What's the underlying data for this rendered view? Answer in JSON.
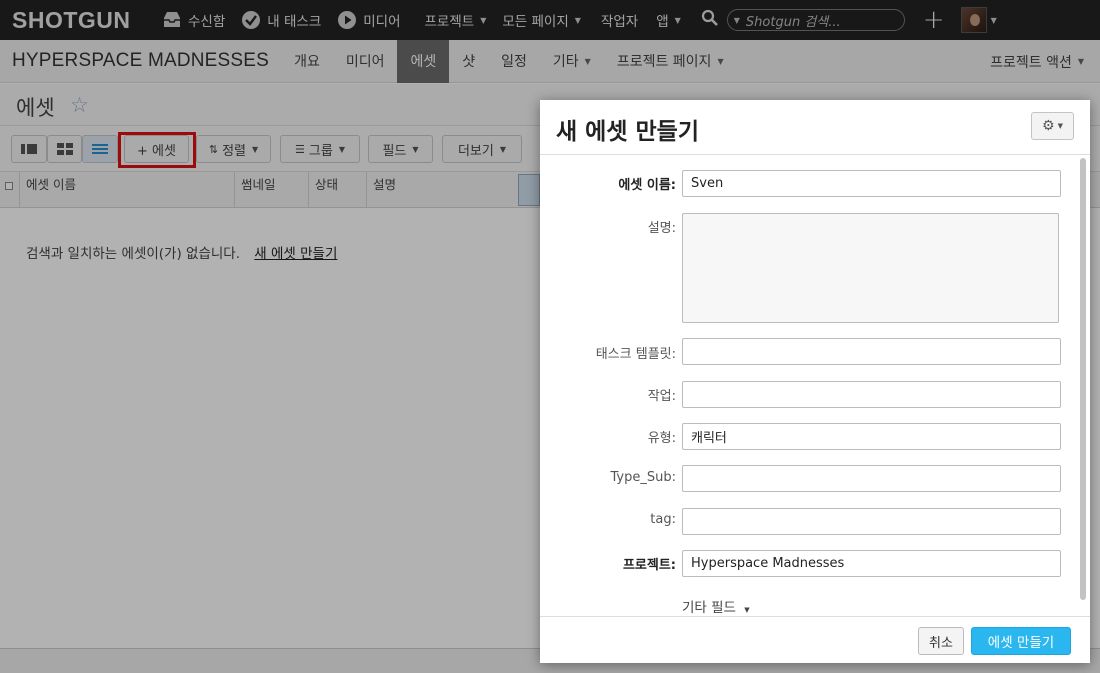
{
  "topnav": {
    "logo": "SHOTGUN",
    "items": [
      {
        "label": "수신함",
        "icon": "inbox-icon"
      },
      {
        "label": "내 태스크",
        "icon": "checkmark-icon"
      },
      {
        "label": "미디어",
        "icon": "play-icon"
      },
      {
        "label": "프로젝트"
      },
      {
        "label": "모든 페이지"
      },
      {
        "label": "작업자"
      },
      {
        "label": "앱"
      }
    ],
    "search_placeholder": "Shotgun 검색..."
  },
  "project": {
    "title": "HYPERSPACE MADNESSES",
    "tabs": [
      "개요",
      "미디어",
      "에셋",
      "샷",
      "일정",
      "기타",
      "프로젝트 페이지"
    ],
    "active_tab": "에셋",
    "actions_label": "프로젝트 액션"
  },
  "page": {
    "title": "에셋",
    "toolbar": {
      "add_label": "+ 에셋",
      "sort_label": "정렬",
      "group_label": "그룹",
      "fields_label": "필드",
      "more_label": "더보기"
    },
    "columns": [
      "에셋 이름",
      "썸네일",
      "상태",
      "설명"
    ],
    "empty_message": "검색과 일치하는 에셋이(가) 없습니다.",
    "empty_link": "새 에셋 만들기"
  },
  "dialog": {
    "title": "새 에셋 만들기",
    "fields": {
      "name": {
        "label": "에셋 이름:",
        "value": "Sven"
      },
      "description": {
        "label": "설명:",
        "value": ""
      },
      "task_template": {
        "label": "태스크 템플릿:",
        "value": ""
      },
      "work": {
        "label": "작업:",
        "value": ""
      },
      "type": {
        "label": "유형:",
        "value": "캐릭터"
      },
      "type_sub": {
        "label": "Type_Sub:",
        "value": ""
      },
      "tag": {
        "label": "tag:",
        "value": ""
      },
      "project": {
        "label": "프로젝트:",
        "value": "Hyperspace Madnesses"
      }
    },
    "more_fields_label": "기타 필드",
    "cancel_label": "취소",
    "create_label": "에셋 만들기"
  },
  "colors": {
    "topnav_bg": "#232323",
    "accent": "#2ab7f0",
    "highlight": "#e01010"
  }
}
